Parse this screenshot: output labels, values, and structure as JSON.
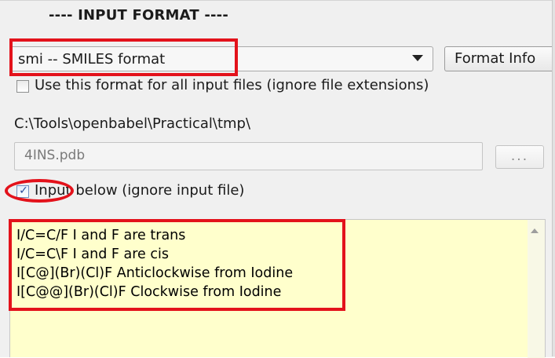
{
  "section": {
    "title": "---- INPUT FORMAT ----"
  },
  "format": {
    "selected": "smi -- SMILES format",
    "info_button": "Format Info"
  },
  "options": {
    "use_format_all": {
      "label": "Use this format for all input files (ignore file extensions)",
      "checked": false
    },
    "input_below": {
      "label": "Input below (ignore input file)",
      "checked": true
    }
  },
  "input_file": {
    "directory": "C:\\Tools\\openbabel\\Practical\\tmp\\",
    "filename": "4INS.pdb",
    "browse_label": "..."
  },
  "input_text": {
    "lines": [
      "I/C=C/F I and F are trans",
      "I/C=C\\F I and F are cis",
      "I[C@](Br)(Cl)F Anticlockwise from Iodine",
      "I[C@@](Br)(Cl)F Clockwise from Iodine"
    ]
  },
  "colors": {
    "highlight": "#e3121b",
    "input_background": "#ffffcc",
    "panel_background": "#f0f0f0"
  },
  "icons": {
    "dropdown": "chevron-down-icon",
    "checkmark": "check-icon",
    "scroll_up": "scroll-up-arrow-icon"
  }
}
